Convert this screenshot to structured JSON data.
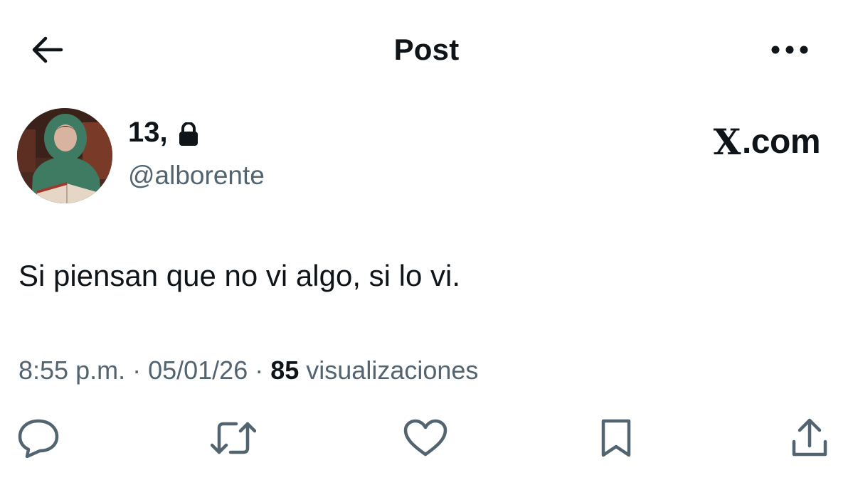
{
  "header": {
    "title": "Post",
    "back_icon": "arrow-left-icon",
    "more_icon": "more-horizontal-icon"
  },
  "author": {
    "display_name": "13,",
    "protected_icon": "lock-icon",
    "handle": "@alborente",
    "avatar": "avatar"
  },
  "brand": {
    "logo": "X",
    "text": ".com"
  },
  "post": {
    "text": "Si piensan que no vi algo, si lo vi."
  },
  "meta": {
    "time": "8:55 p.m.",
    "separator": "·",
    "date": "05/01/26",
    "views_count": "85",
    "views_label": "visualizaciones"
  },
  "actions": [
    {
      "name": "reply",
      "icon": "reply-icon"
    },
    {
      "name": "repost",
      "icon": "repost-icon"
    },
    {
      "name": "like",
      "icon": "heart-icon"
    },
    {
      "name": "bookmark",
      "icon": "bookmark-icon"
    },
    {
      "name": "share",
      "icon": "share-icon"
    }
  ],
  "colors": {
    "text_primary": "#0f1419",
    "text_secondary": "#536471",
    "background": "#ffffff"
  }
}
